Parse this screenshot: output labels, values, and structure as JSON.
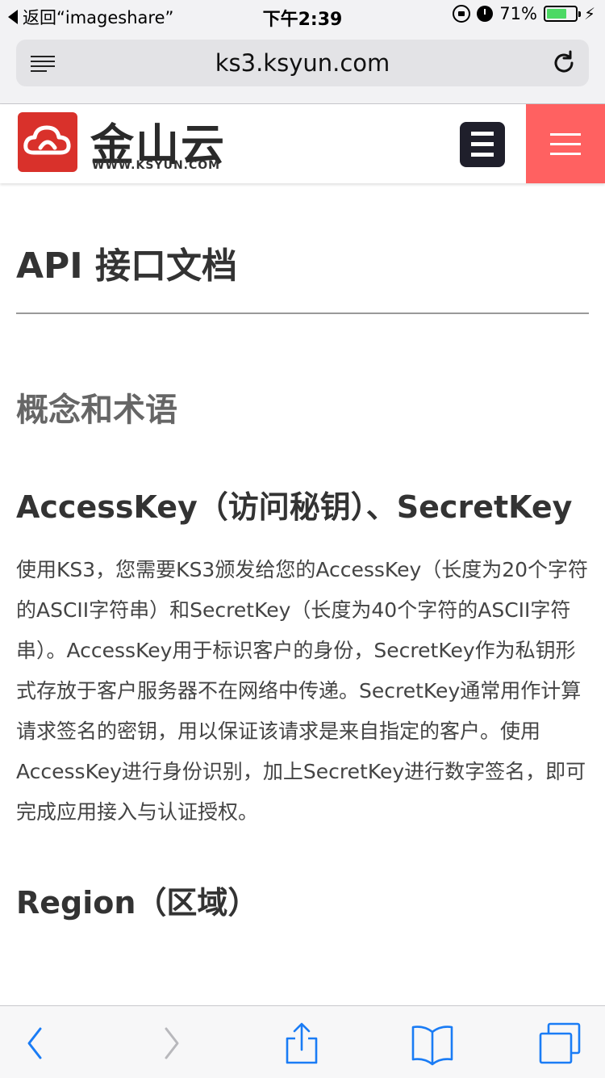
{
  "status_bar": {
    "back_app_label": "返回“imageshare”",
    "time": "下午2:39",
    "battery_percent": "71%",
    "battery_level": 0.71,
    "battery_color": "#4cd964"
  },
  "browser": {
    "url": "ks3.ksyun.com",
    "icons": {
      "reader": "reader-icon",
      "reload": "reload-icon"
    }
  },
  "site_header": {
    "logo_text": "金山云",
    "logo_subtext": "WWW.KSYUN.COM",
    "brand_color": "#d9312b",
    "nav_button_color": "#ff6161"
  },
  "content": {
    "page_title": "API 接口文档",
    "section_title": "概念和术语",
    "subsection_title": "AccessKey（访问秘钥）、SecretKey",
    "paragraph": "使用KS3，您需要KS3颁发给您的AccessKey（长度为20个字符的ASCII字符串）和SecretKey（长度为40个字符的ASCII字符串）。AccessKey用于标识客户的身份，SecretKey作为私钥形式存放于客户服务器不在网络中传递。SecretKey通常用作计算请求签名的密钥，用以保证该请求是来自指定的客户。使用AccessKey进行身份识别，加上SecretKey进行数字签名，即可完成应用接入与认证授权。",
    "next_heading_partial": "Region（区域）"
  },
  "toolbar": {
    "icons": [
      "back-icon",
      "forward-icon",
      "share-icon",
      "bookmarks-icon",
      "tabs-icon"
    ]
  }
}
